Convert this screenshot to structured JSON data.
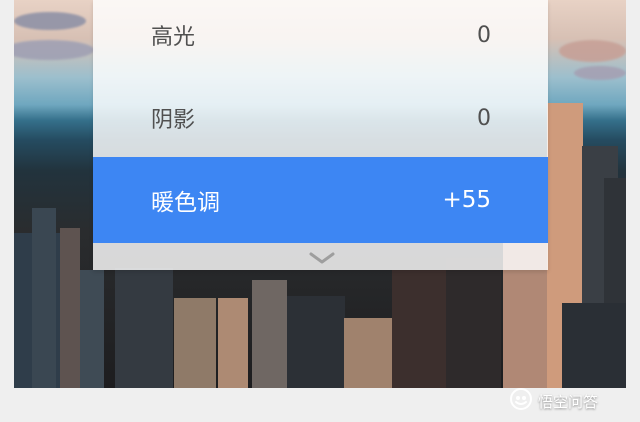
{
  "adjustments": [
    {
      "label": "高光",
      "value": "0"
    },
    {
      "label": "阴影",
      "value": "0"
    },
    {
      "label": "暖色调",
      "value": "+55"
    }
  ],
  "selected_adjustment_index": 2,
  "expand_icon": "chevron-down-icon",
  "watermark": {
    "text": "悟空问答",
    "icon": "wukong-logo-icon"
  },
  "colors": {
    "selected_row": "#3d86f3",
    "panel_bg": "#ffffff",
    "label_text": "#505050",
    "selected_text": "#ffffff"
  }
}
